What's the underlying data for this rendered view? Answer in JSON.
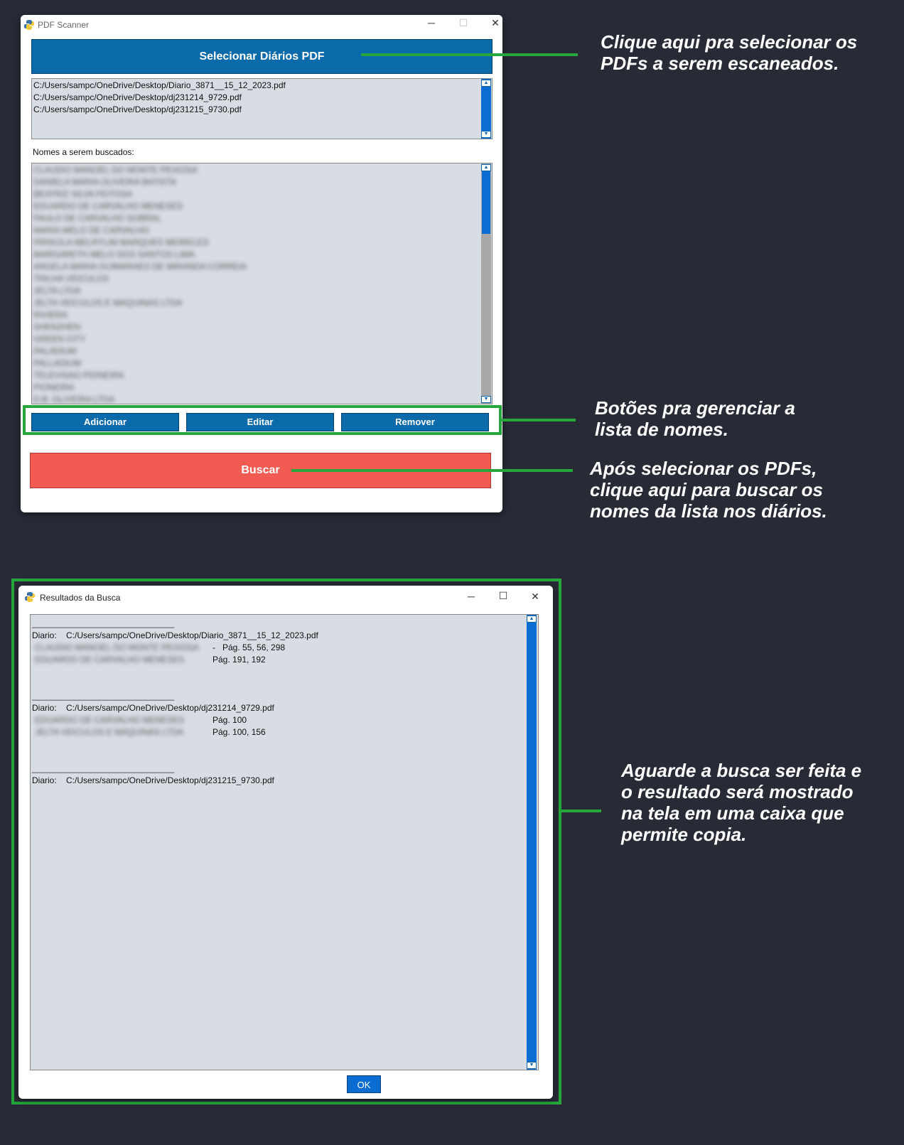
{
  "main_window": {
    "title": "PDF Scanner",
    "select_button": "Selecionar Diários PDF",
    "selected_files": [
      "C:/Users/sampc/OneDrive/Desktop/Diario_3871__15_12_2023.pdf",
      "C:/Users/sampc/OneDrive/Desktop/dj231214_9729.pdf",
      "C:/Users/sampc/OneDrive/Desktop/dj231215_9730.pdf"
    ],
    "names_label": "Nomes a serem buscados:",
    "names": [
      "CLAUDIO MANOEL DO MONTE PEIXOSA",
      "DANIELA MARIA OLIVEIRA BATISTA",
      "BEATRIZ SILVA FEITOSA",
      "EDUARDO DE CARVALHO MENESES",
      "PAULO DE CARVALHO SOBRAL",
      "MARIA MELO DE CARVALHO",
      "PRISCILA MELRYLIM MARQUES MEIRELES",
      "MARGARETH MELO DOS SANTOS LIMA",
      "ANGELA MARIA GUIMARAES DE MIRANDA CORREIA",
      "TRILHA VEICULOS",
      "JELTA LTDA",
      "JELTA VEICULOS E MAQUINAS LTDA",
      "RIVIERA",
      "SHENZHEN",
      "GREEN CITY",
      "PALADIUM",
      "PALLADIUM",
      "TELEVISAO PIONEIRA",
      "PIONEIRA",
      "D.B. OLIVEIRA LTDA"
    ],
    "buttons": {
      "add": "Adicionar",
      "edit": "Editar",
      "remove": "Remover"
    },
    "search_button": "Buscar",
    "colors": {
      "blue_button": "#0a6aaa",
      "search_button": "#f25b52"
    }
  },
  "results_window": {
    "title": "Resultados da Busca",
    "separator": "______________________________",
    "groups": [
      {
        "diario_label": "Diario:",
        "path": "C:/Users/sampc/OneDrive/Desktop/Diario_3871__15_12_2023.pdf",
        "hits": [
          {
            "name": "CLAUDIO MANOEL DO MONTE PEIXOSA",
            "pages": "-   Pág. 55, 56, 298"
          },
          {
            "name": "EDUARDO DE CARVALHO MENESES",
            "pages": "Pág. 191, 192"
          }
        ]
      },
      {
        "diario_label": "Diario:",
        "path": "C:/Users/sampc/OneDrive/Desktop/dj231214_9729.pdf",
        "hits": [
          {
            "name": "EDUARDO DE CARVALHO MENESES",
            "pages": "Pág. 100"
          },
          {
            "name": "JELTA VEICULOS E MAQUINAS LTDA",
            "pages": "Pág. 100, 156"
          }
        ]
      },
      {
        "diario_label": "Diario:",
        "path": "C:/Users/sampc/OneDrive/Desktop/dj231215_9730.pdf",
        "hits": []
      }
    ],
    "ok_button": "OK"
  },
  "annotations": {
    "select": "Clique aqui pra selecionar os PDFs a serem escaneados.",
    "manage": "Botões pra gerenciar a lista de nomes.",
    "search": "Após selecionar os PDFs, clique aqui para buscar os nomes da lista nos diários.",
    "result": "Aguarde a busca ser feita e o resultado será mostrado na tela em uma caixa que permite copia."
  },
  "annotation_color": "#26a63c"
}
